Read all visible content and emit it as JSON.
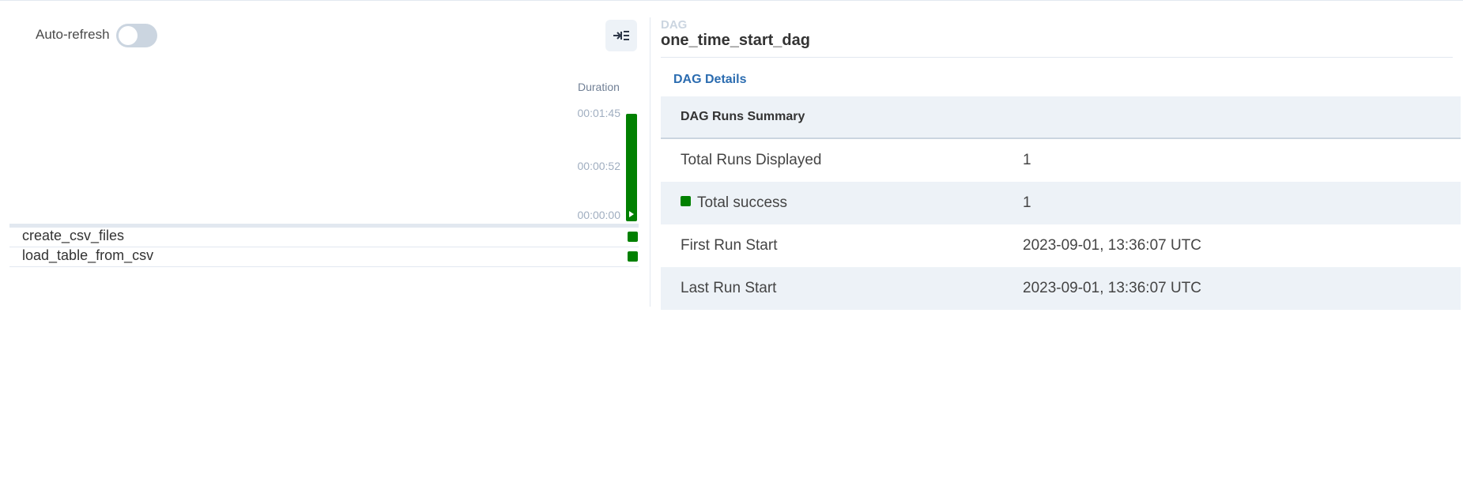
{
  "left": {
    "autorefresh_label": "Auto-refresh",
    "duration_header": "Duration",
    "ticks": [
      "00:01:45",
      "00:00:52",
      "00:00:00"
    ],
    "tasks": [
      {
        "name": "create_csv_files",
        "state": "success"
      },
      {
        "name": "load_table_from_csv",
        "state": "success"
      }
    ]
  },
  "right": {
    "dag_label": "DAG",
    "dag_title": "one_time_start_dag",
    "tab": "DAG Details",
    "summary_header": "DAG Runs Summary",
    "rows": [
      {
        "label": "Total Runs Displayed",
        "value": "1"
      },
      {
        "label": "Total success",
        "value": "1"
      },
      {
        "label": "First Run Start",
        "value": "2023-09-01, 13:36:07 UTC"
      },
      {
        "label": "Last Run Start",
        "value": "2023-09-01, 13:36:07 UTC"
      }
    ]
  },
  "colors": {
    "success": "#008000",
    "tab_accent": "#2b6cb0",
    "alt_row": "#edf2f7"
  }
}
